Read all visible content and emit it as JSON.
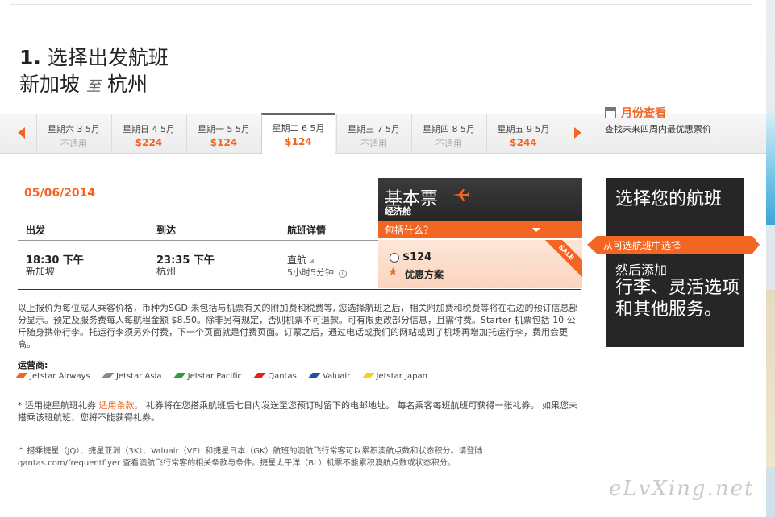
{
  "header": {
    "step_number": "1.",
    "step_title": "选择出发航班",
    "origin": "新加坡",
    "to_word": "至",
    "destination": "杭州"
  },
  "date_strip": {
    "days": [
      {
        "label": "星期六 3 5月",
        "price": "不适用",
        "available": false
      },
      {
        "label": "星期日 4 5月",
        "price": "$224",
        "available": true
      },
      {
        "label": "星期一 5 5月",
        "price": "$124",
        "available": true
      },
      {
        "label": "星期二 6 5月",
        "price": "$124",
        "available": true,
        "selected": true
      },
      {
        "label": "星期三 7 5月",
        "price": "不适用",
        "available": false
      },
      {
        "label": "星期四 8 5月",
        "price": "不适用",
        "available": false
      },
      {
        "label": "星期五 9 5月",
        "price": "$244",
        "available": true
      }
    ],
    "month_view": {
      "title": "月份查看",
      "subtitle": "查找未来四周内最优惠票价"
    }
  },
  "flight": {
    "date": "05/06/2014",
    "columns": {
      "depart": "出发",
      "arrive": "到达",
      "details": "航班详情"
    },
    "depart_time": "18:30 下午",
    "depart_city": "新加坡",
    "arrive_time": "23:35 下午",
    "arrive_city": "杭州",
    "stops": "直航",
    "duration": "5小时5分钟"
  },
  "fare": {
    "name": "基本票",
    "cabin": "经济舱",
    "includes": "包括什么？",
    "sale_badge": "SALE",
    "price": "$124",
    "deal": "优惠方案"
  },
  "notes": {
    "main": "以上报价为每位成人乘客价格，币种为SGD 未包括与机票有关的附加费和税费等, 您选择航班之后，相关附加费和税费等将在右边的预订信息部分显示。预定及服务费每人每航程金额  $8.50。除非另有规定，否则机票不可退款。可有限更改部分信息，且需付费。Starter 机票包括  10 公斤随身携带行李。托运行李须另外付费，下一个页面就是付费页面。订票之后，通过电话或我们的网站或到了机场再增加托运行李，费用会更高。",
    "carriers_title": "运营商:",
    "carriers": [
      {
        "name": "Jetstar Airways",
        "color": "#f26522"
      },
      {
        "name": "Jetstar Asia",
        "color": "#8a8a8a"
      },
      {
        "name": "Jetstar Pacific",
        "color": "#2e9a3c"
      },
      {
        "name": "Qantas",
        "color": "#e2231a"
      },
      {
        "name": "Valuair",
        "color": "#1f4fa3"
      },
      {
        "name": "Jetstar Japan",
        "color": "#f2d21b"
      }
    ],
    "coupon_prefix": "* 适用捷星航班礼券",
    "coupon_link": "适用条款。",
    "coupon_text": "  礼券将在您搭乘航班后七日内发送至您预订时留下的电邮地址。 每名乘客每班航班可获得一张礼券。  如果您未搭乘该班航班，您将不能获得礼券。",
    "ff_text": "^ 搭乘捷星（JQ）、捷星亚洲（3K）、Valuair（VF）和捷星日本（GK）航班的澳航飞行常客可以累积澳航点数和状态积分。请登陆 qantas.com/frequentflyer 查看澳航飞行常客的相关条款与条件。捷星太平洋（BL）机票不能累积澳航点数或状态积分。"
  },
  "promo": {
    "title": "选择您的航班",
    "arrow_text": "从可选航班中选择",
    "then": "然后添加",
    "extras": "行李、灵活选项和其他服务。"
  },
  "watermark": "eLvXing.net",
  "colors": {
    "accent": "#f26522",
    "dark_panel": "#262626"
  }
}
